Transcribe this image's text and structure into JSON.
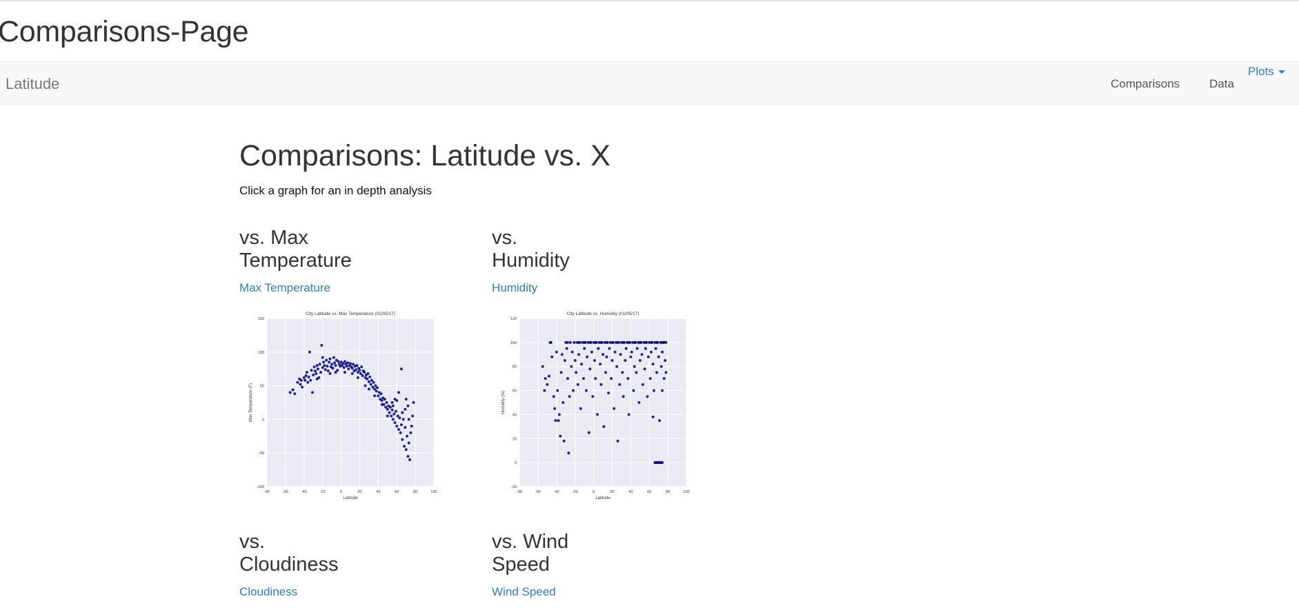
{
  "page_title": "Comparisons-Page",
  "navbar": {
    "brand": "Latitude",
    "links": [
      "Comparisons",
      "Data"
    ],
    "dropdown_label": "Plots"
  },
  "main": {
    "heading": "Comparisons: Latitude vs. X",
    "subtitle": "Click a graph for an in depth analysis"
  },
  "cards": [
    {
      "heading_line1": "vs. Max",
      "heading_line2": "Temperature",
      "link": "Max Temperature"
    },
    {
      "heading_line1": "vs.",
      "heading_line2": "Humidity",
      "link": "Humidity"
    },
    {
      "heading_line1": "vs.",
      "heading_line2": "Cloudiness",
      "link": "Cloudiness"
    },
    {
      "heading_line1": "vs. Wind",
      "heading_line2": "Speed",
      "link": "Wind Speed"
    }
  ],
  "colors": {
    "link": "#337ab7",
    "plot_bg": "#eaeaf2",
    "marker": "#00007a",
    "navbar_bg": "#f8f8f8"
  },
  "chart_data": [
    {
      "type": "scatter",
      "title": "City Latitude vs. Max Temperature (01/05/17)",
      "xlabel": "Latitude",
      "ylabel": "Max Temperature (F)",
      "xlim": [
        -80,
        100
      ],
      "ylim": [
        -100,
        150
      ],
      "xticks": [
        "-80",
        "-60",
        "-40",
        "-20",
        "0",
        "20",
        "40",
        "60",
        "80",
        "100"
      ],
      "yticks": [
        "150",
        "100",
        "50",
        "0",
        "-50",
        "-100"
      ],
      "grid": true,
      "points": [
        [
          -55,
          40
        ],
        [
          -52,
          44
        ],
        [
          -50,
          38
        ],
        [
          -47,
          55
        ],
        [
          -45,
          60
        ],
        [
          -43,
          58
        ],
        [
          -42,
          48
        ],
        [
          -40,
          62
        ],
        [
          -38,
          65
        ],
        [
          -37,
          70
        ],
        [
          -35,
          63
        ],
        [
          -34,
          100
        ],
        [
          -33,
          58
        ],
        [
          -32,
          73
        ],
        [
          -31,
          40
        ],
        [
          -30,
          66
        ],
        [
          -29,
          78
        ],
        [
          -28,
          72
        ],
        [
          -27,
          68
        ],
        [
          -26,
          80
        ],
        [
          -25,
          75
        ],
        [
          -24,
          62
        ],
        [
          -23,
          82
        ],
        [
          -22,
          70
        ],
        [
          -21,
          110
        ],
        [
          -20,
          77
        ],
        [
          -19,
          85
        ],
        [
          -18,
          80
        ],
        [
          -17,
          74
        ],
        [
          -16,
          88
        ],
        [
          -15,
          79
        ],
        [
          -14,
          72
        ],
        [
          -13,
          85
        ],
        [
          -12,
          90
        ],
        [
          -11,
          78
        ],
        [
          -10,
          82
        ],
        [
          -9,
          76
        ],
        [
          -8,
          92
        ],
        [
          -7,
          84
        ],
        [
          -6,
          80
        ],
        [
          -5,
          88
        ],
        [
          -4,
          73
        ],
        [
          -3,
          86
        ],
        [
          -2,
          82
        ],
        [
          -1,
          79
        ],
        [
          0,
          85
        ],
        [
          1,
          80
        ],
        [
          2,
          83
        ],
        [
          3,
          77
        ],
        [
          4,
          86
        ],
        [
          5,
          82
        ],
        [
          6,
          79
        ],
        [
          7,
          84
        ],
        [
          8,
          75
        ],
        [
          9,
          80
        ],
        [
          10,
          83
        ],
        [
          11,
          78
        ],
        [
          12,
          76
        ],
        [
          13,
          82
        ],
        [
          14,
          72
        ],
        [
          15,
          79
        ],
        [
          16,
          74
        ],
        [
          17,
          80
        ],
        [
          18,
          70
        ],
        [
          19,
          76
        ],
        [
          20,
          73
        ],
        [
          21,
          68
        ],
        [
          22,
          78
        ],
        [
          23,
          65
        ],
        [
          24,
          72
        ],
        [
          25,
          70
        ],
        [
          26,
          62
        ],
        [
          27,
          66
        ],
        [
          28,
          60
        ],
        [
          29,
          68
        ],
        [
          30,
          56
        ],
        [
          31,
          63
        ],
        [
          32,
          52
        ],
        [
          33,
          58
        ],
        [
          34,
          48
        ],
        [
          35,
          55
        ],
        [
          36,
          45
        ],
        [
          37,
          50
        ],
        [
          38,
          42
        ],
        [
          39,
          47
        ],
        [
          40,
          35
        ],
        [
          41,
          40
        ],
        [
          42,
          30
        ],
        [
          43,
          38
        ],
        [
          44,
          28
        ],
        [
          45,
          32
        ],
        [
          46,
          22
        ],
        [
          47,
          30
        ],
        [
          48,
          18
        ],
        [
          49,
          25
        ],
        [
          50,
          15
        ],
        [
          51,
          20
        ],
        [
          52,
          10
        ],
        [
          53,
          18
        ],
        [
          54,
          5
        ],
        [
          55,
          14
        ],
        [
          56,
          0
        ],
        [
          57,
          8
        ],
        [
          58,
          -5
        ],
        [
          59,
          12
        ],
        [
          60,
          -10
        ],
        [
          61,
          5
        ],
        [
          62,
          -15
        ],
        [
          63,
          2
        ],
        [
          64,
          -20
        ],
        [
          65,
          -8
        ],
        [
          66,
          -30
        ],
        [
          67,
          0
        ],
        [
          68,
          -40
        ],
        [
          69,
          -12
        ],
        [
          70,
          -45
        ],
        [
          71,
          -25
        ],
        [
          72,
          -55
        ],
        [
          73,
          -35
        ],
        [
          74,
          -60
        ],
        [
          75,
          -20
        ],
        [
          76,
          -10
        ],
        [
          77,
          5
        ],
        [
          78,
          25
        ],
        [
          65,
          75
        ],
        [
          62,
          40
        ],
        [
          70,
          30
        ],
        [
          72,
          20
        ],
        [
          58,
          30
        ],
        [
          55,
          25
        ],
        [
          -44,
          52
        ],
        [
          -36,
          55
        ],
        [
          -39,
          58
        ],
        [
          -26,
          60
        ],
        [
          -20,
          92
        ],
        [
          -12,
          68
        ],
        [
          -6,
          70
        ],
        [
          4,
          70
        ],
        [
          12,
          68
        ],
        [
          18,
          62
        ],
        [
          26,
          50
        ],
        [
          30,
          45
        ],
        [
          36,
          35
        ],
        [
          44,
          22
        ],
        [
          50,
          5
        ],
        [
          56,
          20
        ],
        [
          60,
          28
        ],
        [
          66,
          10
        ],
        [
          69,
          15
        ],
        [
          73,
          0
        ]
      ]
    },
    {
      "type": "scatter",
      "title": "City Latitude vs. Humidity (01/05/17)",
      "xlabel": "Latitude",
      "ylabel": "Humidity (%)",
      "xlim": [
        -80,
        100
      ],
      "ylim": [
        -20,
        120
      ],
      "xticks": [
        "-80",
        "-60",
        "-40",
        "-20",
        "0",
        "20",
        "40",
        "60",
        "80",
        "100"
      ],
      "yticks": [
        "120",
        "100",
        "80",
        "60",
        "40",
        "20",
        "0",
        "-20"
      ],
      "grid": true,
      "points": [
        [
          -55,
          80
        ],
        [
          -53,
          60
        ],
        [
          -52,
          70
        ],
        [
          -50,
          65
        ],
        [
          -48,
          72
        ],
        [
          -47,
          100
        ],
        [
          -45,
          88
        ],
        [
          -43,
          55
        ],
        [
          -42,
          45
        ],
        [
          -41,
          35
        ],
        [
          -40,
          92
        ],
        [
          -39,
          60
        ],
        [
          -38,
          35
        ],
        [
          -37,
          40
        ],
        [
          -36,
          22
        ],
        [
          -35,
          75
        ],
        [
          -34,
          90
        ],
        [
          -33,
          50
        ],
        [
          -32,
          18
        ],
        [
          -31,
          85
        ],
        [
          -30,
          100
        ],
        [
          -29,
          95
        ],
        [
          -28,
          70
        ],
        [
          -27,
          8
        ],
        [
          -26,
          55
        ],
        [
          -25,
          100
        ],
        [
          -24,
          80
        ],
        [
          -23,
          92
        ],
        [
          -22,
          60
        ],
        [
          -21,
          100
        ],
        [
          -20,
          85
        ],
        [
          -19,
          75
        ],
        [
          -18,
          100
        ],
        [
          -17,
          65
        ],
        [
          -16,
          90
        ],
        [
          -15,
          100
        ],
        [
          -14,
          45
        ],
        [
          -13,
          82
        ],
        [
          -12,
          100
        ],
        [
          -11,
          70
        ],
        [
          -10,
          95
        ],
        [
          -9,
          100
        ],
        [
          -8,
          60
        ],
        [
          -7,
          88
        ],
        [
          -6,
          100
        ],
        [
          -5,
          25
        ],
        [
          -4,
          78
        ],
        [
          -3,
          100
        ],
        [
          -2,
          92
        ],
        [
          -1,
          55
        ],
        [
          0,
          100
        ],
        [
          1,
          85
        ],
        [
          2,
          70
        ],
        [
          3,
          100
        ],
        [
          4,
          40
        ],
        [
          5,
          95
        ],
        [
          6,
          100
        ],
        [
          7,
          82
        ],
        [
          8,
          65
        ],
        [
          9,
          100
        ],
        [
          10,
          90
        ],
        [
          11,
          30
        ],
        [
          12,
          100
        ],
        [
          13,
          75
        ],
        [
          14,
          88
        ],
        [
          15,
          100
        ],
        [
          16,
          58
        ],
        [
          17,
          95
        ],
        [
          18,
          100
        ],
        [
          19,
          70
        ],
        [
          20,
          85
        ],
        [
          21,
          100
        ],
        [
          22,
          45
        ],
        [
          23,
          92
        ],
        [
          24,
          100
        ],
        [
          25,
          80
        ],
        [
          26,
          18
        ],
        [
          27,
          100
        ],
        [
          28,
          65
        ],
        [
          29,
          90
        ],
        [
          30,
          100
        ],
        [
          31,
          75
        ],
        [
          32,
          55
        ],
        [
          33,
          100
        ],
        [
          34,
          85
        ],
        [
          35,
          95
        ],
        [
          36,
          100
        ],
        [
          37,
          70
        ],
        [
          38,
          40
        ],
        [
          39,
          100
        ],
        [
          40,
          88
        ],
        [
          41,
          92
        ],
        [
          42,
          100
        ],
        [
          43,
          60
        ],
        [
          44,
          80
        ],
        [
          45,
          100
        ],
        [
          46,
          75
        ],
        [
          47,
          95
        ],
        [
          48,
          100
        ],
        [
          49,
          50
        ],
        [
          50,
          85
        ],
        [
          51,
          100
        ],
        [
          52,
          90
        ],
        [
          53,
          65
        ],
        [
          54,
          100
        ],
        [
          55,
          78
        ],
        [
          56,
          95
        ],
        [
          57,
          100
        ],
        [
          58,
          55
        ],
        [
          59,
          88
        ],
        [
          60,
          100
        ],
        [
          61,
          70
        ],
        [
          62,
          92
        ],
        [
          63,
          100
        ],
        [
          64,
          82
        ],
        [
          65,
          60
        ],
        [
          66,
          100
        ],
        [
          67,
          95
        ],
        [
          68,
          75
        ],
        [
          69,
          100
        ],
        [
          70,
          88
        ],
        [
          71,
          35
        ],
        [
          72,
          100
        ],
        [
          73,
          80
        ],
        [
          74,
          92
        ],
        [
          75,
          100
        ],
        [
          76,
          70
        ],
        [
          77,
          85
        ],
        [
          78,
          75
        ],
        [
          74,
          60
        ],
        [
          66,
          0
        ],
        [
          67,
          0
        ],
        [
          68,
          0
        ],
        [
          69,
          0
        ],
        [
          70,
          0
        ],
        [
          71,
          0
        ],
        [
          72,
          0
        ],
        [
          73,
          0
        ],
        [
          74,
          0
        ],
        [
          64,
          38
        ],
        [
          -16,
          100
        ],
        [
          -10,
          100
        ],
        [
          -4,
          100
        ],
        [
          2,
          100
        ],
        [
          8,
          100
        ],
        [
          14,
          100
        ],
        [
          20,
          100
        ],
        [
          26,
          100
        ],
        [
          32,
          100
        ],
        [
          38,
          100
        ],
        [
          44,
          100
        ],
        [
          50,
          100
        ],
        [
          56,
          100
        ],
        [
          62,
          100
        ],
        [
          68,
          100
        ],
        [
          74,
          100
        ],
        [
          76,
          100
        ],
        [
          78,
          100
        ],
        [
          -46,
          100
        ],
        [
          -28,
          100
        ]
      ]
    }
  ]
}
